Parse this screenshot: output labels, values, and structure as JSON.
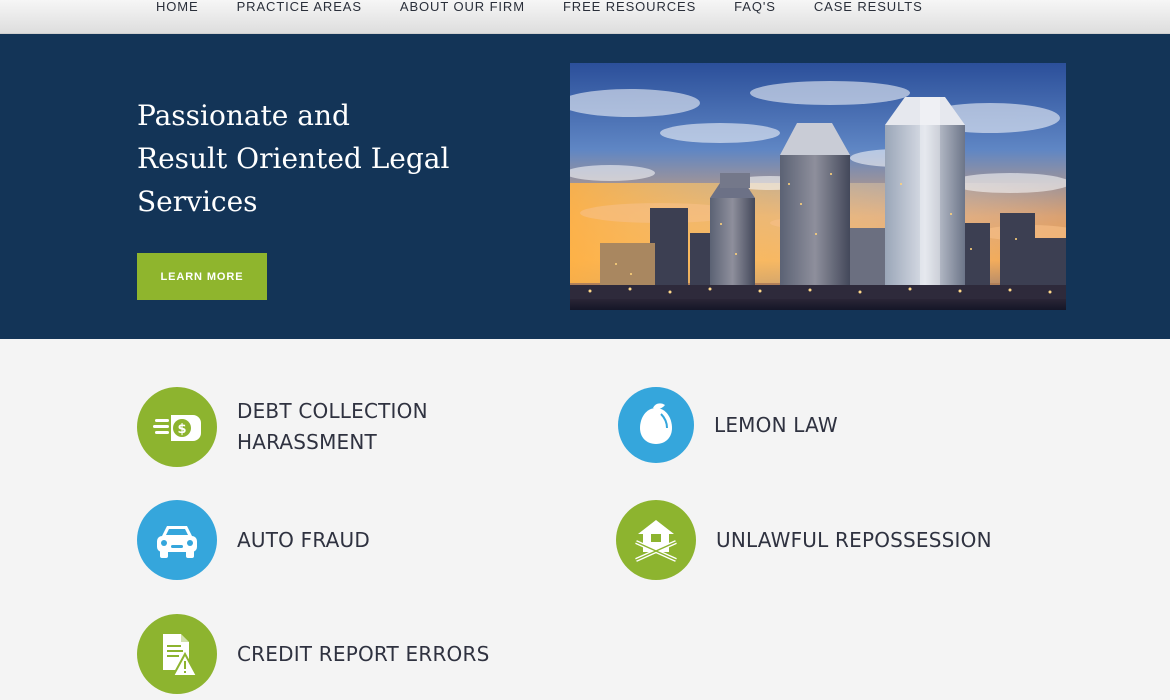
{
  "nav": {
    "items": [
      "HOME",
      "PRACTICE AREAS",
      "ABOUT OUR FIRM",
      "FREE RESOURCES",
      "FAQ'S",
      "CASE RESULTS"
    ]
  },
  "hero": {
    "title_lines": [
      "Passionate and",
      "Result Oriented Legal",
      "Services"
    ],
    "button_label": "LEARN MORE",
    "image": "city-skyline-photo"
  },
  "practice_areas": [
    {
      "lines": [
        "DEBT COLLECTION",
        "HARASSMENT"
      ],
      "icon": "money-hand-icon",
      "color": "#8db42f"
    },
    {
      "lines": [
        "LEMON LAW"
      ],
      "icon": "lemon-icon",
      "color": "#35a6dc"
    },
    {
      "lines": [
        "AUTO FRAUD"
      ],
      "icon": "car-icon",
      "color": "#35a6dc"
    },
    {
      "lines": [
        "UNLAWFUL REPOSSESSION"
      ],
      "icon": "house-repossession-icon",
      "color": "#8db42f"
    },
    {
      "lines": [
        "CREDIT REPORT ERRORS"
      ],
      "icon": "document-warning-icon",
      "color": "#8db42f"
    }
  ],
  "colors": {
    "hero_bg": "#133457",
    "accent_green": "#8fb52d",
    "accent_blue": "#35a6dc"
  }
}
